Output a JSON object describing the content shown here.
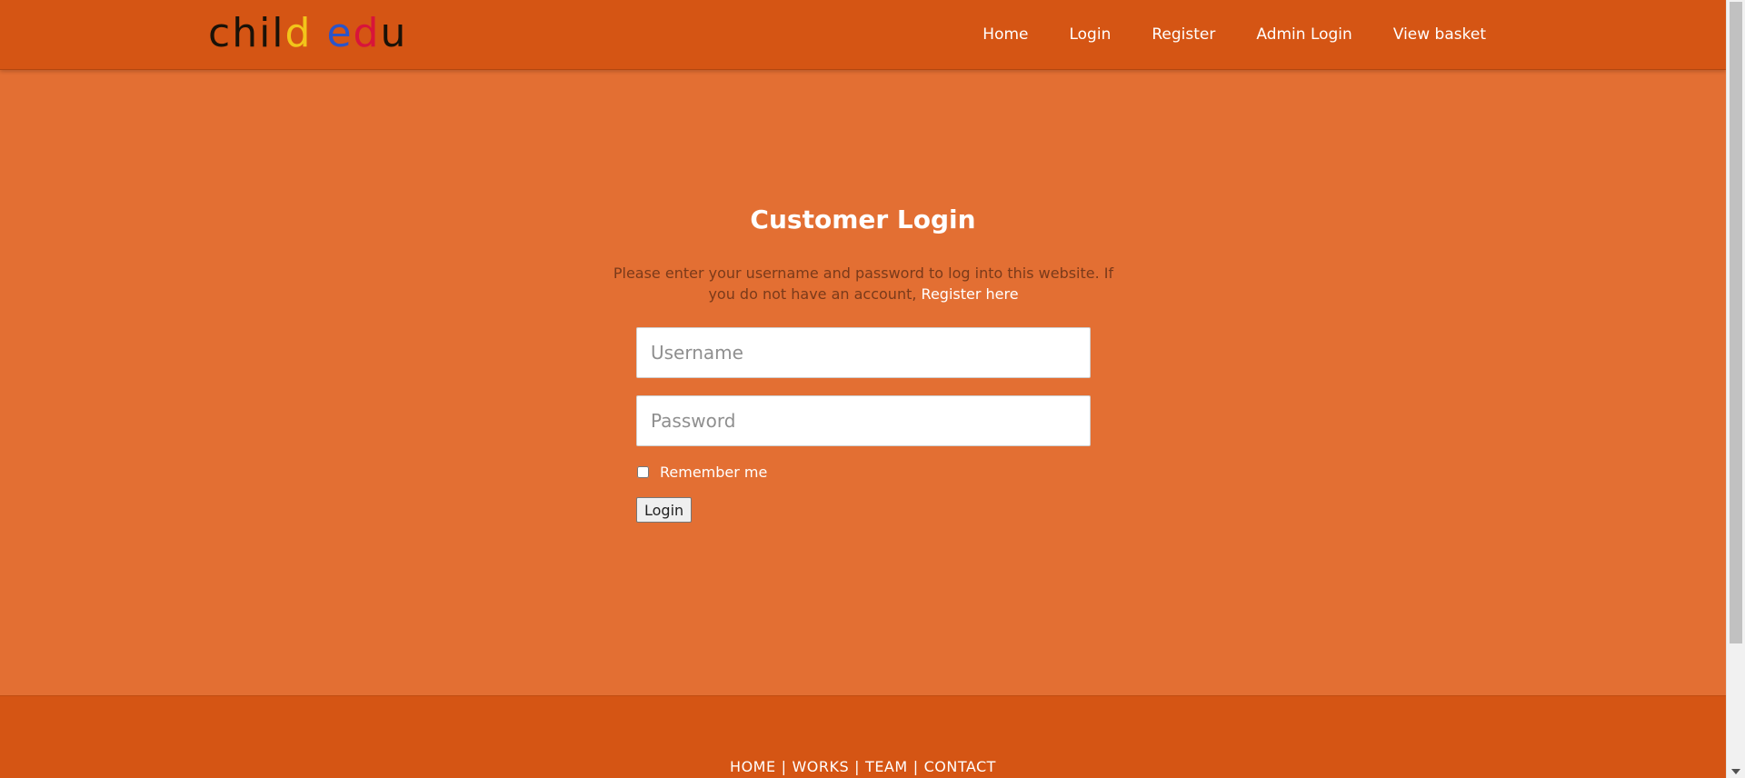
{
  "logo": {
    "part1": "child ",
    "letter_y": "e",
    "letter_b": "d",
    "letter_r": "u",
    "full_text": "child edu"
  },
  "nav": {
    "items": [
      {
        "label": "Home"
      },
      {
        "label": "Login"
      },
      {
        "label": "Register"
      },
      {
        "label": "Admin Login"
      },
      {
        "label": "View basket"
      }
    ]
  },
  "login": {
    "title": "Customer Login",
    "intro_text": "Please enter your username and password to log into this website. If you do not have an account,",
    "register_link": "Register here",
    "username_placeholder": "Username",
    "password_placeholder": "Password",
    "remember_label": "Remember me",
    "remember_checked": false,
    "button_label": "Login"
  },
  "footer": {
    "links": [
      "HOME",
      "WORKS",
      "TEAM",
      "CONTACT"
    ],
    "separator": "|"
  },
  "colors": {
    "header_bg": "#d55514",
    "main_bg": "#e36f33",
    "footer_bg": "#d55514",
    "text_white": "#ffffff",
    "intro_text": "#7a3a1a"
  }
}
